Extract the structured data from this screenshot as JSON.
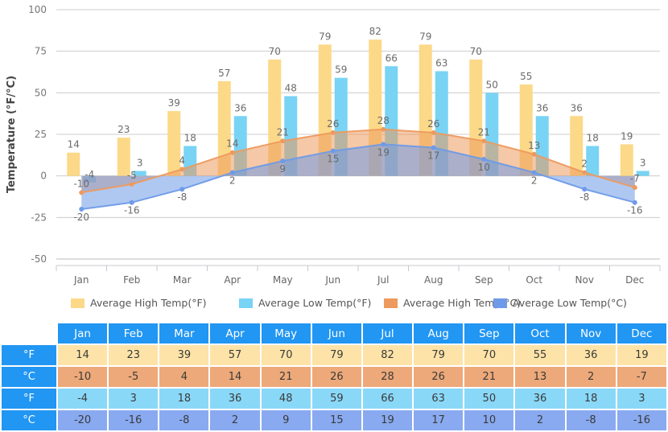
{
  "chart_data": {
    "type": "bar",
    "title": "",
    "xlabel": "",
    "ylabel": "Temperature (°F/°C)",
    "ylim": [
      -50,
      100
    ],
    "yticks": [
      -50,
      -25,
      0,
      25,
      50,
      75,
      100
    ],
    "grid": true,
    "legend_position": "bottom",
    "categories": [
      "Jan",
      "Feb",
      "Mar",
      "Apr",
      "May",
      "Jun",
      "Jul",
      "Aug",
      "Sep",
      "Oct",
      "Nov",
      "Dec"
    ],
    "series": [
      {
        "name": "Average High Temp(°F)",
        "type": "bar",
        "color": "#fcd988",
        "values": [
          14,
          23,
          39,
          57,
          70,
          79,
          82,
          79,
          70,
          55,
          36,
          19
        ]
      },
      {
        "name": "Average Low Temp(°F)",
        "type": "bar",
        "color": "#79d3f4",
        "values": [
          -4,
          3,
          18,
          36,
          48,
          59,
          66,
          63,
          50,
          36,
          18,
          3
        ]
      },
      {
        "name": "Average High Temp(°C)",
        "type": "area",
        "color": "#ed9a5e",
        "values": [
          -10,
          -5,
          4,
          14,
          21,
          26,
          28,
          26,
          21,
          13,
          2,
          -7
        ]
      },
      {
        "name": "Average Low Temp(°C)",
        "type": "area",
        "color": "#6e9ae8",
        "values": [
          -20,
          -16,
          -8,
          2,
          9,
          15,
          19,
          17,
          10,
          2,
          -8,
          -16
        ]
      }
    ]
  },
  "legend": {
    "items": [
      {
        "label": "Average High Temp(°F)",
        "color": "#fcd988"
      },
      {
        "label": "Average Low Temp(°F)",
        "color": "#79d3f4"
      },
      {
        "label": "Average High Temp(°C)",
        "color": "#ed9a5e"
      },
      {
        "label": "Average Low Temp(°C)",
        "color": "#6e9ae8"
      }
    ]
  },
  "table": {
    "corner": "",
    "columns": [
      "Jan",
      "Feb",
      "Mar",
      "Apr",
      "May",
      "Jun",
      "Jul",
      "Aug",
      "Sep",
      "Oct",
      "Nov",
      "Dec"
    ],
    "rows": [
      {
        "head": "°F",
        "style": "cell-hf",
        "values": [
          "14",
          "23",
          "39",
          "57",
          "70",
          "79",
          "82",
          "79",
          "70",
          "55",
          "36",
          "19"
        ]
      },
      {
        "head": "°C",
        "style": "cell-hc",
        "values": [
          "-10",
          "-5",
          "4",
          "14",
          "21",
          "26",
          "28",
          "26",
          "21",
          "13",
          "2",
          "-7"
        ]
      },
      {
        "head": "°F",
        "style": "cell-lf",
        "values": [
          "-4",
          "3",
          "18",
          "36",
          "48",
          "59",
          "66",
          "63",
          "50",
          "36",
          "18",
          "3"
        ]
      },
      {
        "head": "°C",
        "style": "cell-lc",
        "values": [
          "-20",
          "-16",
          "-8",
          "2",
          "9",
          "15",
          "19",
          "17",
          "10",
          "2",
          "-8",
          "-16"
        ]
      }
    ]
  },
  "colors": {
    "high_f": "#fcd988",
    "low_f": "#79d3f4",
    "high_c": "#ed9a5e",
    "low_c": "#6e9ae8",
    "table_header": "#2196f3",
    "grid": "#cccccc"
  }
}
